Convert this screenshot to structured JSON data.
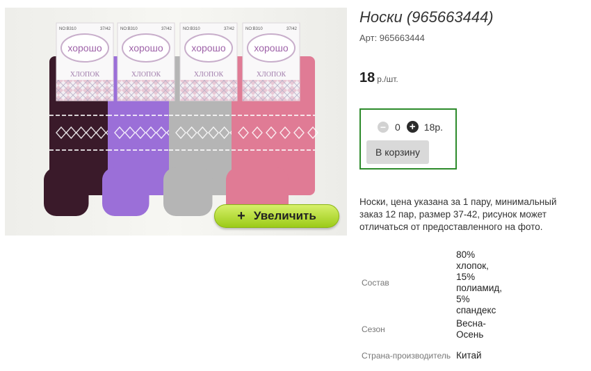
{
  "product": {
    "title": "Носки (965663444)",
    "sku_label": "Арт:",
    "sku_value": "965663444",
    "sku_text": "Арт: 965663444",
    "price": "18",
    "price_unit": "р./шт.",
    "description": "Носки, цена указана за 1 пару, минимальный заказ 12 пар, размер 37-42, рисунок может отличаться от предоставленного на фото."
  },
  "image": {
    "zoom_label": "Увеличить",
    "package_brand": "хорошо",
    "package_text": "ХЛОПОК",
    "package_code": "NO:B310",
    "package_size": "37/42",
    "sock_colors": [
      "#3a1a2a",
      "#9b6fd8",
      "#b5b5b5",
      "#e07b95"
    ]
  },
  "buy": {
    "quantity": "0",
    "total": "18р.",
    "cart_button": "В корзину",
    "border_color": "#2c8a2a"
  },
  "properties": [
    {
      "key": "Состав",
      "value": "80% хлопок, 15% полиамид, 5% спандекс"
    },
    {
      "key": "Сезон",
      "value": "Весна-Осень"
    },
    {
      "key": "Страна-производитель",
      "value": "Китай"
    }
  ]
}
